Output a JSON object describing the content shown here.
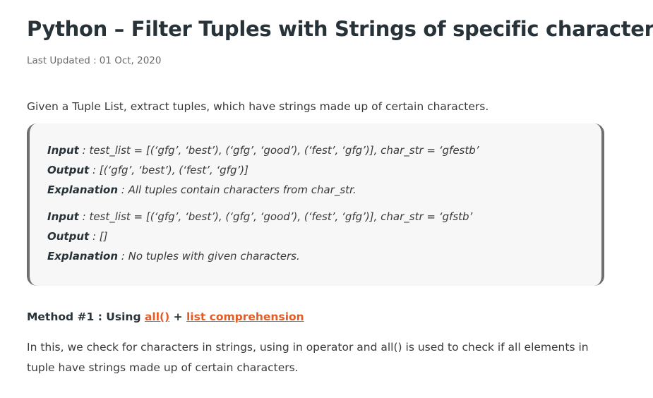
{
  "article": {
    "title": "Python – Filter Tuples with Strings of specific characters",
    "updated_label": "Last Updated :",
    "updated_date": "01 Oct, 2020",
    "intro": "Given a Tuple List, extract tuples, which have strings made up of certain characters.",
    "examples": [
      {
        "input_key": "Input",
        "input_value": " : test_list = [(‘gfg’, ‘best’), (‘gfg’, ‘good’), (‘fest’, ‘gfg’)], char_str = ‘gfestb’",
        "output_key": "Output",
        "output_value": " : [(‘gfg’, ‘best’), (‘fest’, ‘gfg’)]",
        "explanation_key": "Explanation",
        "explanation_value": " : All tuples contain characters from char_str."
      },
      {
        "input_key": "Input",
        "input_value": " : test_list = [(‘gfg’, ‘best’), (‘gfg’, ‘good’), (‘fest’, ‘gfg’)], char_str = ‘gfstb’",
        "output_key": "Output",
        "output_value": " : []",
        "explanation_key": "Explanation",
        "explanation_value": " : No tuples with given characters."
      }
    ],
    "method": {
      "prefix": "Method #1 : Using ",
      "link1": "all()",
      "joiner": " + ",
      "link2": "list comprehension"
    },
    "body": "In this, we check for characters in strings, using in operator and all() is used to check if all elements in tuple have strings made up of certain characters."
  },
  "colors": {
    "text": "#273239",
    "link": "#e45b24",
    "box_background": "#f7f7f7",
    "box_border": "#6f6f6f"
  }
}
